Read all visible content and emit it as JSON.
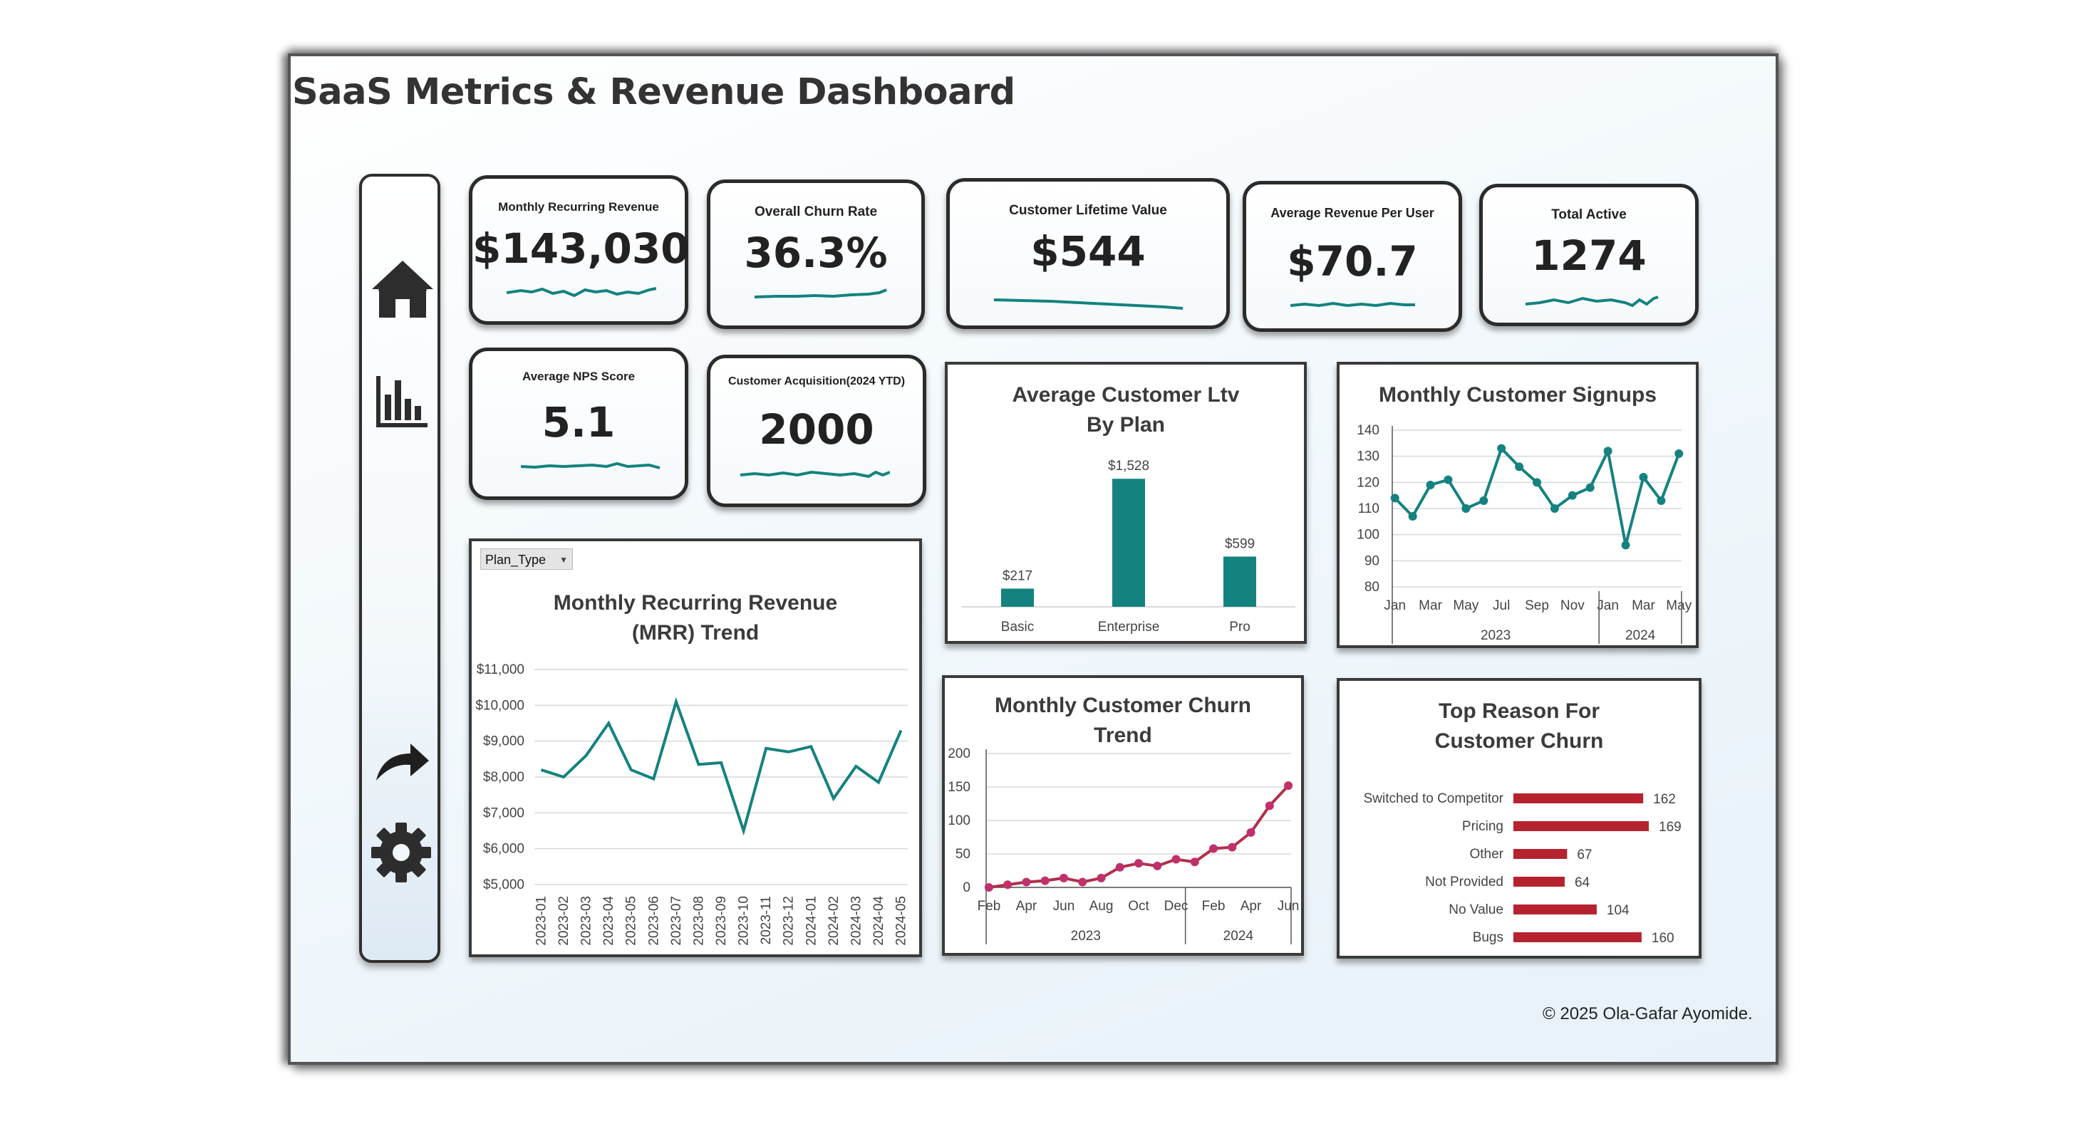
{
  "dashboard": {
    "title": "SaaS Metrics & Revenue Dashboard",
    "copyright": "© 2025 Ola-Gafar Ayomide."
  },
  "sidebar": {
    "icons": [
      "home-icon",
      "bar-chart-icon",
      "share-arrow-icon",
      "gear-icon"
    ]
  },
  "kpis": {
    "mrr": {
      "label": "Monthly Recurring Revenue",
      "value": "$143,030"
    },
    "churn_rate": {
      "label": "Overall Churn Rate",
      "value": "36.3%"
    },
    "clv": {
      "label": "Customer Lifetime Value",
      "value": "$544"
    },
    "arpu": {
      "label": "Average Revenue Per User",
      "value": "$70.7"
    },
    "total_active": {
      "label": "Total Active",
      "value": "1274"
    },
    "nps": {
      "label": "Average NPS Score",
      "value": "5.1"
    },
    "acquisition": {
      "label": "Customer Acquisition(2024 YTD)",
      "value": "2000"
    }
  },
  "slicer": {
    "label": "Plan_Type"
  },
  "colors": {
    "teal": "#14827f",
    "crimson": "#b5232f",
    "magenta_marker": "#c0306a",
    "line_red": "#b03048"
  },
  "chart_data": [
    {
      "id": "mrr_trend",
      "type": "line",
      "title": "Monthly Recurring Revenue (MRR) Trend",
      "x": [
        "2023-01",
        "2023-02",
        "2023-03",
        "2023-04",
        "2023-05",
        "2023-06",
        "2023-07",
        "2023-08",
        "2023-09",
        "2023-10",
        "2023-11",
        "2023-12",
        "2024-01",
        "2024-02",
        "2024-03",
        "2024-04",
        "2024-05"
      ],
      "values": [
        8200,
        8000,
        8600,
        9500,
        8200,
        7950,
        10100,
        8350,
        8400,
        6500,
        8800,
        8700,
        8850,
        7400,
        8300,
        7850,
        9300
      ],
      "y_ticks": [
        "$5,000",
        "$6,000",
        "$7,000",
        "$8,000",
        "$9,000",
        "$10,000",
        "$11,000"
      ],
      "ylim": [
        5000,
        11000
      ],
      "grid": true
    },
    {
      "id": "ltv_by_plan",
      "type": "bar",
      "title": "Average Customer Ltv By Plan",
      "categories": [
        "Basic",
        "Enterprise",
        "Pro"
      ],
      "values": [
        217,
        1528,
        599
      ],
      "data_labels": [
        "$217",
        "$1,528",
        "$599"
      ],
      "ylim": [
        0,
        1700
      ]
    },
    {
      "id": "signups",
      "type": "line",
      "title": "Monthly Customer Signups",
      "x_ticks": [
        "Jan",
        "Mar",
        "May",
        "Jul",
        "Sep",
        "Nov",
        "Jan",
        "Mar",
        "May"
      ],
      "x_groups": [
        "2023",
        "2024"
      ],
      "values": [
        114,
        107,
        119,
        121,
        110,
        113,
        133,
        126,
        120,
        110,
        115,
        118,
        132,
        96,
        122,
        113,
        131
      ],
      "y_ticks": [
        "80",
        "90",
        "100",
        "110",
        "120",
        "130",
        "140"
      ],
      "ylim": [
        80,
        140
      ],
      "grid": true
    },
    {
      "id": "churn_trend",
      "type": "line",
      "title": "Monthly Customer Churn Trend",
      "x_ticks": [
        "Feb",
        "Apr",
        "Jun",
        "Aug",
        "Oct",
        "Dec",
        "Feb",
        "Apr",
        "Jun"
      ],
      "x_groups": [
        "2023",
        "2024"
      ],
      "values": [
        0,
        4,
        8,
        10,
        14,
        8,
        14,
        30,
        36,
        32,
        42,
        38,
        58,
        60,
        82,
        122,
        152
      ],
      "y_ticks": [
        "0",
        "50",
        "100",
        "150",
        "200"
      ],
      "ylim": [
        0,
        200
      ],
      "grid": true
    },
    {
      "id": "churn_reasons",
      "type": "bar",
      "orientation": "horizontal",
      "title": "Top Reason For Customer Churn",
      "categories": [
        "Switched to Competitor",
        "Pricing",
        "Other",
        "Not Provided",
        "No Value",
        "Bugs"
      ],
      "values": [
        162,
        169,
        67,
        64,
        104,
        160
      ]
    }
  ]
}
